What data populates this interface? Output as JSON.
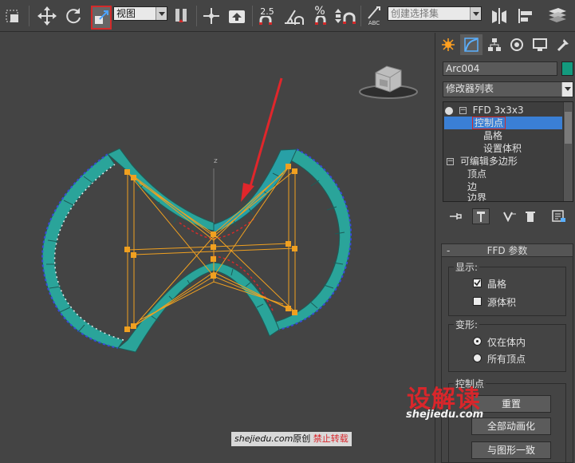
{
  "toolbar": {
    "view_dropdown": "视图",
    "snap_25": "2.5",
    "percent": "%",
    "abc": "ABC",
    "selection_set": "创建选择集"
  },
  "viewport": {
    "axis_label": "z"
  },
  "panel": {
    "object_name": "Arc004",
    "object_color": "#139a7e",
    "modifier_list": "修改器列表",
    "stack": [
      {
        "label": "FFD 3x3x3"
      },
      {
        "label": "控制点",
        "selected": true
      },
      {
        "label": "晶格"
      },
      {
        "label": "设置体积"
      },
      {
        "label": "可编辑多边形"
      },
      {
        "label": "顶点"
      },
      {
        "label": "边"
      },
      {
        "label": "边界"
      }
    ],
    "ffd_rollout": {
      "minus": "-",
      "title": "FFD 参数",
      "display_group": "显示:",
      "lattice_label": "晶格",
      "lattice_checked": true,
      "source_volume_label": "源体积",
      "source_volume_checked": false,
      "deform_group": "变形:",
      "only_in_volume": "仅在体内",
      "all_vertices": "所有顶点",
      "selected_deform": "仅在体内",
      "control_points_group": "控制点",
      "reset_button": "重置",
      "animate_all_button": "全部动画化",
      "conform_button": "与图形一致"
    }
  },
  "watermark": {
    "brand": "设解读",
    "site": "shejiedu.com",
    "footer_site": "shejiedu.com",
    "footer_original": "原创",
    "footer_warning": "禁止转载"
  },
  "colors": {
    "accent_red": "#d42a2a",
    "mesh_teal": "#2aa49a",
    "lattice_orange": "#f0a020",
    "selection_blue": "#3a7fd5"
  }
}
